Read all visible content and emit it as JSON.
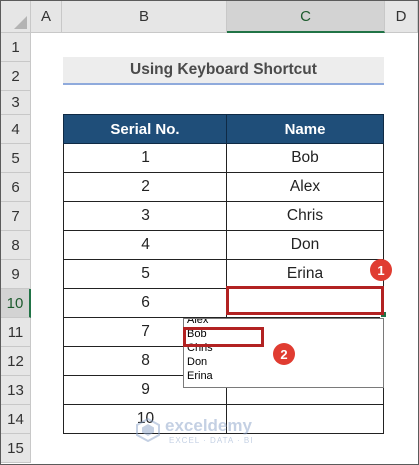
{
  "columns": [
    "A",
    "B",
    "C",
    "D"
  ],
  "rows": [
    "1",
    "2",
    "3",
    "4",
    "5",
    "6",
    "7",
    "8",
    "9",
    "10",
    "11",
    "12",
    "13",
    "14",
    "15"
  ],
  "selected_column": "C",
  "selected_row": "10",
  "title": "Using Keyboard Shortcut",
  "table": {
    "headers": [
      "Serial No.",
      "Name"
    ],
    "rows": [
      {
        "serial": "1",
        "name": "Bob"
      },
      {
        "serial": "2",
        "name": "Alex"
      },
      {
        "serial": "3",
        "name": "Chris"
      },
      {
        "serial": "4",
        "name": "Don"
      },
      {
        "serial": "5",
        "name": "Erina"
      },
      {
        "serial": "6",
        "name": ""
      },
      {
        "serial": "7",
        "name": ""
      },
      {
        "serial": "8",
        "name": ""
      },
      {
        "serial": "9",
        "name": ""
      },
      {
        "serial": "10",
        "name": ""
      }
    ]
  },
  "dropdown": {
    "options": [
      "Alex",
      "Bob",
      "Chris",
      "Don",
      "Erina"
    ],
    "highlighted": "Bob"
  },
  "annotations": {
    "badge_1": "1",
    "badge_2": "2"
  },
  "watermark": {
    "name": "exceldemy",
    "tagline": "EXCEL · DATA · BI"
  },
  "colors": {
    "table_header": "#1f4e79",
    "selection": "#217346",
    "highlight": "#b22222",
    "badge": "#e03c31"
  }
}
